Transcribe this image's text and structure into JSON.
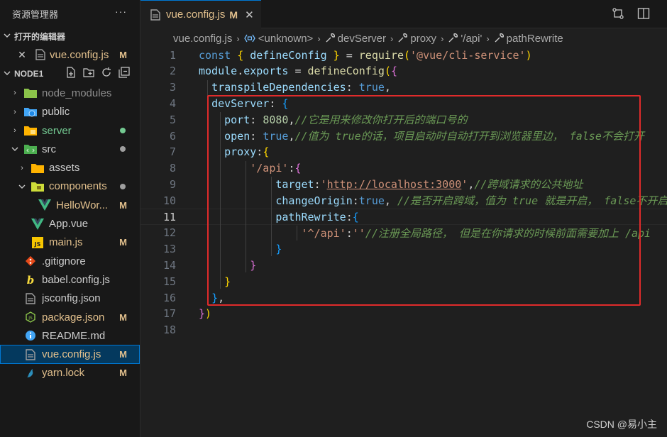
{
  "explorer": {
    "title": "资源管理器",
    "more": "···",
    "open_editors": {
      "label": "打开的编辑器",
      "items": [
        {
          "name": "vue.config.js",
          "badge": "M"
        }
      ]
    },
    "project": {
      "label": "NODE1",
      "items": [
        {
          "name": "node_modules",
          "icon": "folder-green-icon",
          "color": "#8c8c8c"
        },
        {
          "name": "public",
          "icon": "folder-globe-icon",
          "color": "#cccccc"
        },
        {
          "name": "server",
          "icon": "folder-yellow-icon",
          "color": "#73c991"
        },
        {
          "name": "src",
          "icon": "folder-src-icon",
          "color": "#cccccc"
        },
        {
          "name": "assets",
          "icon": "folder-yellow-icon",
          "color": "#cccccc"
        },
        {
          "name": "components",
          "icon": "folder-components-icon",
          "color": "#e2c08d"
        },
        {
          "name": "HelloWor...",
          "icon": "vue-icon",
          "badge": "M",
          "color": "#e2c08d"
        },
        {
          "name": "App.vue",
          "icon": "vue-icon",
          "color": "#cccccc"
        },
        {
          "name": "main.js",
          "icon": "js-icon",
          "badge": "M",
          "color": "#e2c08d"
        },
        {
          "name": ".gitignore",
          "icon": "git-icon",
          "color": "#cccccc"
        },
        {
          "name": "babel.config.js",
          "icon": "babel-icon",
          "color": "#cccccc"
        },
        {
          "name": "jsconfig.json",
          "icon": "file-icon",
          "color": "#cccccc"
        },
        {
          "name": "package.json",
          "icon": "nodejs-icon",
          "badge": "M",
          "color": "#e2c08d"
        },
        {
          "name": "README.md",
          "icon": "info-icon",
          "color": "#cccccc"
        },
        {
          "name": "vue.config.js",
          "icon": "file-icon",
          "badge": "M",
          "color": "#e2c08d"
        },
        {
          "name": "yarn.lock",
          "icon": "yarn-icon",
          "badge": "M",
          "color": "#e2c08d"
        }
      ]
    }
  },
  "tab": {
    "name": "vue.config.js",
    "badge": "M",
    "close": "✕"
  },
  "breadcrumb": [
    "vue.config.js",
    "<unknown>",
    "devServer",
    "proxy",
    "'/api'",
    "pathRewrite"
  ],
  "code": {
    "line_numbers": [
      "1",
      "2",
      "3",
      "4",
      "5",
      "6",
      "7",
      "8",
      "9",
      "10",
      "11",
      "12",
      "13",
      "14",
      "15",
      "16",
      "17",
      "18"
    ],
    "active_line": "11",
    "lines": [
      [
        [
          "k",
          "const "
        ],
        [
          "b1",
          "{ "
        ],
        [
          "v",
          "defineConfig"
        ],
        [
          "b1",
          " }"
        ],
        [
          "p",
          " = "
        ],
        [
          "f",
          "require"
        ],
        [
          "b1",
          "("
        ],
        [
          "s",
          "'@vue/cli-service'"
        ],
        [
          "b1",
          ")"
        ]
      ],
      [
        [
          "v",
          "module"
        ],
        [
          "p",
          "."
        ],
        [
          "v",
          "exports"
        ],
        [
          "p",
          " = "
        ],
        [
          "f",
          "defineConfig"
        ],
        [
          "b1",
          "("
        ],
        [
          "b2",
          "{"
        ]
      ],
      [
        [
          "p",
          "  "
        ],
        [
          "v",
          "transpileDependencies"
        ],
        [
          "p",
          ": "
        ],
        [
          "k",
          "true"
        ],
        [
          "p",
          ","
        ]
      ],
      [
        [
          "p",
          "  "
        ],
        [
          "v",
          "devServer"
        ],
        [
          "p",
          ": "
        ],
        [
          "b3",
          "{"
        ]
      ],
      [
        [
          "p",
          "    "
        ],
        [
          "v",
          "port"
        ],
        [
          "p",
          ": "
        ],
        [
          "n",
          "8080"
        ],
        [
          "p",
          ","
        ],
        [
          "c",
          "//它是用来修改你打开后的端口号的"
        ]
      ],
      [
        [
          "p",
          "    "
        ],
        [
          "v",
          "open"
        ],
        [
          "p",
          ": "
        ],
        [
          "k",
          "true"
        ],
        [
          "p",
          ","
        ],
        [
          "c",
          "//值为 true的话，项目启动时自动打开到浏览器里边， false不会打开"
        ]
      ],
      [
        [
          "p",
          "    "
        ],
        [
          "v",
          "proxy"
        ],
        [
          "p",
          ":"
        ],
        [
          "b1",
          "{"
        ]
      ],
      [
        [
          "p",
          "        "
        ],
        [
          "s",
          "'/api'"
        ],
        [
          "p",
          ":"
        ],
        [
          "b2",
          "{"
        ]
      ],
      [
        [
          "p",
          "            "
        ],
        [
          "v",
          "target"
        ],
        [
          "p",
          ":"
        ],
        [
          "s",
          "'"
        ],
        [
          "su",
          "http://localhost:3000"
        ],
        [
          "s",
          "'"
        ],
        [
          "p",
          ","
        ],
        [
          "c",
          "//跨域请求的公共地址"
        ]
      ],
      [
        [
          "p",
          "            "
        ],
        [
          "v",
          "changeOrigin"
        ],
        [
          "p",
          ":"
        ],
        [
          "k",
          "true"
        ],
        [
          "p",
          ", "
        ],
        [
          "c",
          "//是否开启跨域，值为 true 就是开启， false不开启"
        ]
      ],
      [
        [
          "p",
          "            "
        ],
        [
          "v",
          "pathRewrite"
        ],
        [
          "p",
          ":"
        ],
        [
          "b3",
          "{"
        ]
      ],
      [
        [
          "p",
          "                "
        ],
        [
          "s",
          "'^/api'"
        ],
        [
          "p",
          ":"
        ],
        [
          "s",
          "''"
        ],
        [
          "c",
          "//注册全局路径， 但是在你请求的时候前面需要加上 /api"
        ]
      ],
      [
        [
          "p",
          "            "
        ],
        [
          "b3",
          "}"
        ]
      ],
      [
        [
          "p",
          "        "
        ],
        [
          "b2",
          "}"
        ]
      ],
      [
        [
          "p",
          "    "
        ],
        [
          "b1",
          "}"
        ]
      ],
      [
        [
          "p",
          "  "
        ],
        [
          "b3",
          "}"
        ],
        [
          "p",
          ","
        ]
      ],
      [
        [
          "b2",
          "}"
        ],
        [
          "b1",
          ")"
        ]
      ],
      []
    ]
  },
  "watermark": "CSDN @易小主"
}
